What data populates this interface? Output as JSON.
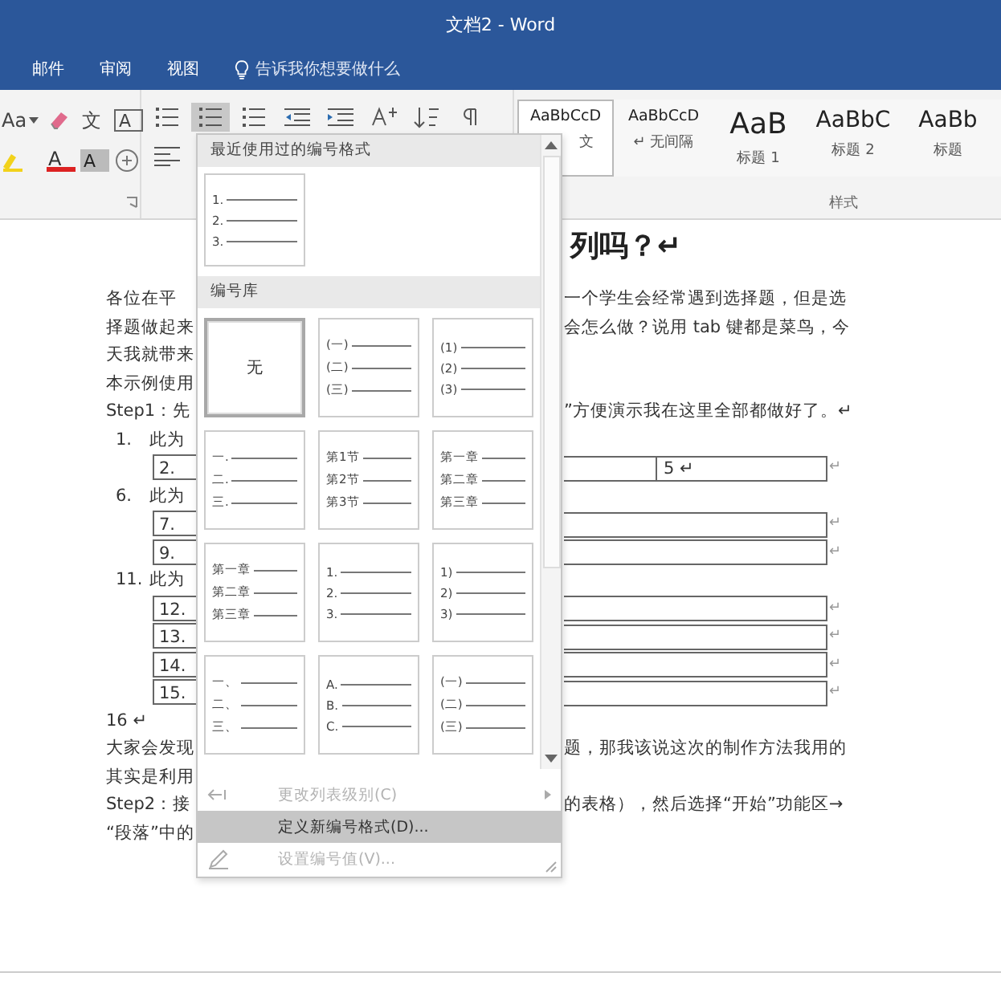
{
  "window": {
    "title": "文档2 - Word"
  },
  "ribbon_tabs": [
    {
      "label": "邮件"
    },
    {
      "label": "审阅"
    },
    {
      "label": "视图"
    }
  ],
  "tell_me": {
    "placeholder": "告诉我你想要做什么"
  },
  "font_tools": [
    {
      "kind": "change_case",
      "glyph": "Aa"
    },
    {
      "kind": "clear_format"
    },
    {
      "kind": "phonetic",
      "glyph": "文"
    },
    {
      "kind": "char_border",
      "glyph": "A"
    },
    {
      "kind": "highlight"
    },
    {
      "kind": "font_color",
      "glyph": "A"
    },
    {
      "kind": "char_shading",
      "glyph": "A"
    },
    {
      "kind": "enclose"
    }
  ],
  "paragraph_tools": [
    [
      {
        "kind": "bullets",
        "selected": false
      },
      {
        "kind": "numbering",
        "selected": true
      },
      {
        "kind": "multilevel",
        "selected": false
      },
      {
        "kind": "outdent",
        "selected": false
      },
      {
        "kind": "indent",
        "selected": false
      },
      {
        "kind": "asian_layout",
        "selected": false
      },
      {
        "kind": "sort",
        "selected": false
      },
      {
        "kind": "show_marks",
        "selected": false
      }
    ],
    [
      {
        "kind": "align_left",
        "selected": false
      }
    ]
  ],
  "styles": {
    "items": [
      {
        "preview": "AaBbCcD",
        "name": "文",
        "kind": "body",
        "selected": true
      },
      {
        "preview": "AaBbCcD",
        "name": "↵ 无间隔",
        "kind": "body",
        "selected": false
      },
      {
        "preview": "AaB",
        "name": "标题 1",
        "kind": "heading1",
        "selected": false
      },
      {
        "preview": "AaBbC",
        "name": "标题 2",
        "kind": "heading2",
        "selected": false
      },
      {
        "preview": "AaBb",
        "name": "标题",
        "kind": "title",
        "selected": false
      }
    ],
    "label": "样式"
  },
  "document": {
    "lines": [
      {
        "kind": "heading",
        "right": "列吗？↵"
      },
      {
        "kind": "text",
        "left": "各位在平",
        "right": "一个学生会经常遇到选择题，但是选"
      },
      {
        "kind": "text",
        "left": "择题做起来",
        "right": "会怎么做？说用 tab 键都是菜鸟，今"
      },
      {
        "kind": "text",
        "left": "天我就带来"
      },
      {
        "kind": "text",
        "left": "本示例使用"
      },
      {
        "kind": "text",
        "left": "Step1：先",
        "right": "”方便演示我在这里全部都做好了。↵"
      },
      {
        "kind": "list_item",
        "number": "1.",
        "left": "此为"
      },
      {
        "kind": "table_row",
        "number": "2.",
        "value": "5 ↵",
        "end": "↵"
      },
      {
        "kind": "list_item",
        "number": "6.",
        "left": "此为"
      },
      {
        "kind": "table_row",
        "number": "7.",
        "end": "↵"
      },
      {
        "kind": "table_row",
        "number": "9.",
        "end": "↵"
      },
      {
        "kind": "list_item",
        "number": "11.",
        "left": "此为"
      },
      {
        "kind": "table_row",
        "number": "12.",
        "end": "↵"
      },
      {
        "kind": "table_row",
        "number": "13.",
        "end": "↵"
      },
      {
        "kind": "table_row",
        "number": "14.",
        "end": "↵"
      },
      {
        "kind": "table_row",
        "number": "15.",
        "end": "↵"
      },
      {
        "kind": "text",
        "left": "16 ↵"
      },
      {
        "kind": "text",
        "left": "大家会发现",
        "right": "题，那我该说这次的制作方法我用的"
      },
      {
        "kind": "text",
        "left": "其实是利用"
      },
      {
        "kind": "text",
        "left": "Step2：接",
        "right": "的表格），然后选择“开始”功能区→"
      },
      {
        "kind": "text",
        "left": "“段落”中的"
      }
    ]
  },
  "numbering_menu": {
    "recent_header": "最近使用过的编号格式",
    "recent": [
      {
        "kind": "list",
        "lines": [
          "1.",
          "2.",
          "3."
        ]
      }
    ],
    "library_header": "编号库",
    "library": [
      {
        "kind": "none",
        "label": "无",
        "selected": true
      },
      {
        "kind": "list",
        "lines": [
          "(一)",
          "(二)",
          "(三)"
        ],
        "selected": false
      },
      {
        "kind": "list",
        "lines": [
          "(1)",
          "(2)",
          "(3)"
        ],
        "selected": false
      },
      {
        "kind": "list",
        "lines": [
          "一.",
          "二.",
          "三."
        ],
        "selected": false
      },
      {
        "kind": "list",
        "lines": [
          "第1节",
          "第2节",
          "第3节"
        ],
        "selected": false
      },
      {
        "kind": "list",
        "lines": [
          "第一章",
          "第二章",
          "第三章"
        ],
        "selected": false
      },
      {
        "kind": "list",
        "lines": [
          "第一章",
          "第二章",
          "第三章"
        ],
        "selected": false
      },
      {
        "kind": "list",
        "lines": [
          "1.",
          "2.",
          "3."
        ],
        "selected": false
      },
      {
        "kind": "list",
        "lines": [
          "1)",
          "2)",
          "3)"
        ],
        "selected": false
      },
      {
        "kind": "list",
        "lines": [
          "一、",
          "二、",
          "三、"
        ],
        "selected": false
      },
      {
        "kind": "list",
        "lines": [
          "A.",
          "B.",
          "C."
        ],
        "selected": false
      },
      {
        "kind": "list",
        "lines": [
          "(一)",
          "(二)",
          "(三)"
        ],
        "selected": false
      }
    ],
    "actions": [
      {
        "kind": "change_level",
        "label": "更改列表级别(C)",
        "disabled": true,
        "selected": false,
        "submenu": true
      },
      {
        "kind": "define_format",
        "label": "定义新编号格式(D)...",
        "disabled": false,
        "selected": true,
        "submenu": false
      },
      {
        "kind": "set_value",
        "label": "设置编号值(V)...",
        "disabled": true,
        "selected": false,
        "submenu": false
      }
    ]
  }
}
